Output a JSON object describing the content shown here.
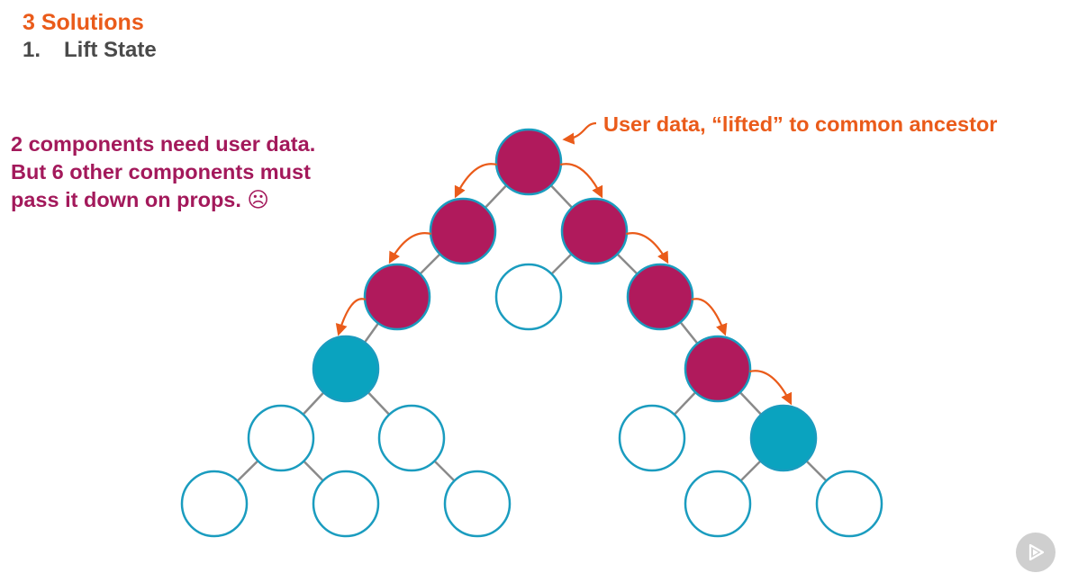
{
  "slide": {
    "title": "3 Solutions",
    "list_number": "1.",
    "list_item": "Lift State"
  },
  "note": {
    "lines": [
      "2 components need user data.",
      "But 6 other components must",
      "pass it down on props. ☹"
    ]
  },
  "callout": {
    "text": "User data, “lifted” to common ancestor"
  },
  "colors": {
    "heading": "#ea5b1a",
    "subheading": "#4a4a4a",
    "note_text": "#a3195b",
    "arrow": "#ea5b1a",
    "edge": "#8a8a8a",
    "node_outline": "#1a9cbf",
    "node_prop_passer": "#b01a5c",
    "node_data_consumer": "#0aa3bf",
    "node_empty": "#ffffff",
    "badge": "#cfcfcf"
  },
  "tree": {
    "legend_states": [
      "prop-passer",
      "data-consumer",
      "empty"
    ],
    "node_states": {
      "root": "prop-passer",
      "l1a": "prop-passer",
      "l1b": "prop-passer",
      "l2a": "prop-passer",
      "l2b": "empty",
      "l2c": "prop-passer",
      "l3a": "data-consumer",
      "l3b": "prop-passer",
      "l4a": "empty",
      "l4b": "empty",
      "l4c": "empty",
      "l4d": "data-consumer",
      "l5a": "empty",
      "l5b": "empty",
      "l5c": "empty",
      "l5d": "empty",
      "l5e": "empty"
    },
    "edges": [
      [
        "root",
        "l1a"
      ],
      [
        "root",
        "l1b"
      ],
      [
        "l1a",
        "l2a"
      ],
      [
        "l1b",
        "l2b"
      ],
      [
        "l1b",
        "l2c"
      ],
      [
        "l2a",
        "l3a"
      ],
      [
        "l2c",
        "l3b"
      ],
      [
        "l3a",
        "l4a"
      ],
      [
        "l3a",
        "l4b"
      ],
      [
        "l3b",
        "l4c"
      ],
      [
        "l3b",
        "l4d"
      ],
      [
        "l4a",
        "l5a"
      ],
      [
        "l4a",
        "l5b"
      ],
      [
        "l4b",
        "l5c"
      ],
      [
        "l4d",
        "l5d"
      ],
      [
        "l4d",
        "l5e"
      ]
    ],
    "prop_flow": [
      [
        "root",
        "l1a"
      ],
      [
        "root",
        "l1b"
      ],
      [
        "l1a",
        "l2a"
      ],
      [
        "l2a",
        "l3a"
      ],
      [
        "l1b",
        "l2c"
      ],
      [
        "l2c",
        "l3b"
      ],
      [
        "l3b",
        "l4d"
      ]
    ]
  },
  "badge": {
    "icon": "play-logo-icon"
  }
}
